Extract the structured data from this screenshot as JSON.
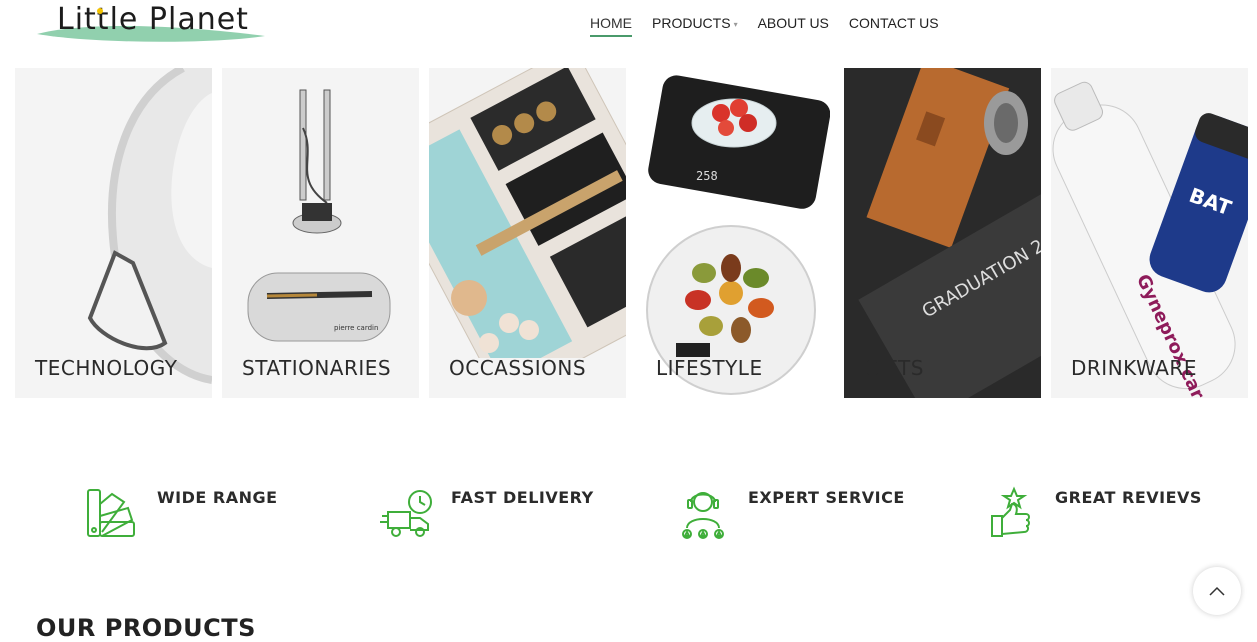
{
  "brand": {
    "name": "Little Planet",
    "colors": {
      "accent": "#4a9a6b",
      "icon_green": "#3fae3a",
      "swoosh": "#7ec8a0"
    }
  },
  "nav": {
    "items": [
      {
        "label": "HOME",
        "active": true
      },
      {
        "label": "PRODUCTS",
        "has_dropdown": true
      },
      {
        "label": "ABOUT US"
      },
      {
        "label": "CONTACT US"
      }
    ]
  },
  "categories": [
    {
      "label": "TECHNOLOGY"
    },
    {
      "label": "STATIONARIES"
    },
    {
      "label": "OCCASSIONS"
    },
    {
      "label": "LIFESTYLE"
    },
    {
      "label": "GIFTS"
    },
    {
      "label": "DRINKWARE"
    }
  ],
  "features": [
    {
      "label": "WIDE RANGE",
      "icon": "color-swatch-icon"
    },
    {
      "label": "FAST DELIVERY",
      "icon": "delivery-truck-icon"
    },
    {
      "label": "EXPERT SERVICE",
      "icon": "support-agent-icon"
    },
    {
      "label": "GREAT REVIEVS",
      "icon": "thumbs-up-star-icon"
    }
  ],
  "section": {
    "title": "OUR PRODUCTS"
  },
  "scroll_top": {
    "icon": "chevron-up-icon"
  }
}
